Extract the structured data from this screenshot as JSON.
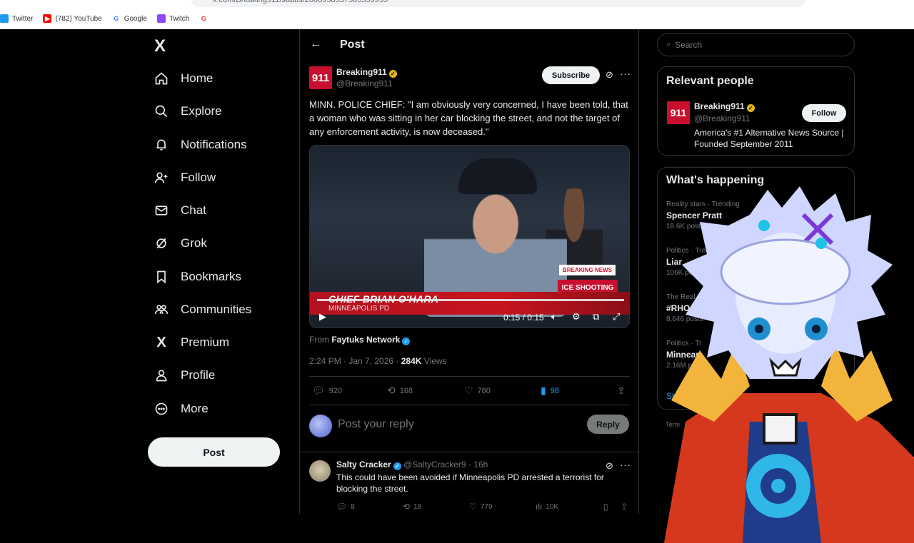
{
  "browser": {
    "url": "x.com/Breaking911/status/2008958537585559955",
    "bookmarks": [
      {
        "label": "Twitter",
        "color": "#1d9bf0",
        "glyph": "t"
      },
      {
        "label": "(782) YouTube",
        "color": "#ff0000",
        "glyph": "▶"
      },
      {
        "label": "Google",
        "color": "#4285f4",
        "glyph": "G"
      },
      {
        "label": "Twitch",
        "color": "#9146ff",
        "glyph": "T"
      },
      {
        "label": "",
        "color": "#ea4335",
        "glyph": "G"
      }
    ]
  },
  "nav": {
    "logo": "X",
    "items": [
      {
        "label": "Home",
        "icon": "home-icon"
      },
      {
        "label": "Explore",
        "icon": "search-icon"
      },
      {
        "label": "Notifications",
        "icon": "bell-icon"
      },
      {
        "label": "Follow",
        "icon": "person-add-icon"
      },
      {
        "label": "Chat",
        "icon": "mail-icon"
      },
      {
        "label": "Grok",
        "icon": "grok-icon"
      },
      {
        "label": "Bookmarks",
        "icon": "bookmark-icon"
      },
      {
        "label": "Communities",
        "icon": "people-icon"
      },
      {
        "label": "Premium",
        "icon": "x-icon"
      },
      {
        "label": "Profile",
        "icon": "person-icon"
      },
      {
        "label": "More",
        "icon": "more-circle-icon"
      }
    ],
    "post_button": "Post"
  },
  "post": {
    "header_title": "Post",
    "author_name": "Breaking911",
    "author_handle": "@Breaking911",
    "avatar_text": "911",
    "subscribe_label": "Subscribe",
    "text": "MINN. POLICE CHIEF: \"I am obviously very concerned, I have been told, that a woman who was sitting in her car blocking the street, and not the target of any enforcement activity, is now deceased.\"",
    "video": {
      "lower_third_name": "CHIEF BRIAN O'HARA",
      "lower_third_sub": "MINNEAPOLIS PD",
      "breaking_label": "BREAKING NEWS",
      "topic_label": "ICE SHOOTING",
      "time": "0:15 / 0:15",
      "progress": 1.0
    },
    "from_prefix": "From",
    "from_source": "Faytuks Network",
    "timestamp": "2:24 PM · Jan 7, 2026 · ",
    "views_count": "284K",
    "views_label": "Views",
    "stats": {
      "replies": "920",
      "reposts": "168",
      "likes": "780",
      "bookmarks": "98"
    },
    "reply_placeholder": "Post your reply",
    "reply_button": "Reply"
  },
  "comment": {
    "name": "Salty Cracker",
    "handle": "@SaltyCracker9 · 16h",
    "text": "This could have been avoided if Minneapolis PD arrested a terrorist for blocking the street.",
    "stats": {
      "replies": "8",
      "reposts": "18",
      "likes": "779",
      "views": "10K"
    }
  },
  "sidebar": {
    "search_placeholder": "Search",
    "relevant_title": "Relevant people",
    "relevant": {
      "name": "Breaking911",
      "handle": "@Breaking911",
      "avatar_text": "911",
      "bio": "America's #1 Alternative News Source | Founded September 2011",
      "follow_label": "Follow"
    },
    "happening_title": "What's happening",
    "trends": [
      {
        "context": "Reality stars · Trending",
        "title": "Spencer Pratt",
        "count": "18.6K posts"
      },
      {
        "context": "Politics · Trending",
        "title": "Liar",
        "count": "106K posts"
      },
      {
        "context": "The Real Housewives of Sa",
        "title": "#RHOSLC",
        "count": "8,646 posts"
      },
      {
        "context": "Politics · Tr",
        "title": "Minneap",
        "count": "2.16M posts"
      }
    ],
    "show_more": "Show m",
    "footer": "Term"
  }
}
